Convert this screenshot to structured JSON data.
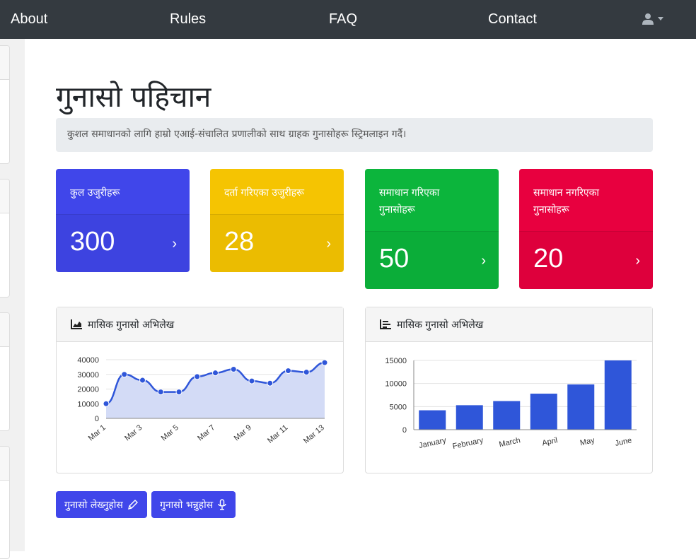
{
  "nav": {
    "about": "About",
    "rules": "Rules",
    "faq": "FAQ",
    "contact": "Contact",
    "user_icon": "user-icon"
  },
  "header": {
    "title": "गुनासो पहिचान",
    "lead": "कुशल समाधानको लागि हाम्रो एआई-संचालित प्रणालीको साथ ग्राहक गुनासोहरू स्ट्रिमलाइन गर्दै।"
  },
  "stats": [
    {
      "label": "कुल उजुरीहरू",
      "value": "300",
      "color": "#4046ea"
    },
    {
      "label": "दर्ता गरिएका उजुरीहरू",
      "value": "28",
      "color": "#f5c402"
    },
    {
      "label": "समाधान गरिएका गुनासोहरू",
      "value": "50",
      "color": "#0cb53c"
    },
    {
      "label": "समाधान नगरिएका गुनासोहरू",
      "value": "20",
      "color": "#e8003f"
    }
  ],
  "cards": {
    "line_title": "मासिक गुनासो अभिलेख",
    "bar_title": "मासिक गुनासो अभिलेख"
  },
  "buttons": {
    "write": "गुनासो लेख्नुहोस",
    "speak": "गुनासो भन्नुहोस"
  },
  "chart_data": [
    {
      "type": "area",
      "x": [
        "Mar 1",
        "Mar 2",
        "Mar 3",
        "Mar 4",
        "Mar 5",
        "Mar 6",
        "Mar 7",
        "Mar 8",
        "Mar 9",
        "Mar 10",
        "Mar 11",
        "Mar 12",
        "Mar 13"
      ],
      "x_tick_labels": [
        "Mar 1",
        "Mar 3",
        "Mar 5",
        "Mar 7",
        "Mar 9",
        "Mar 11",
        "Mar 13"
      ],
      "values": [
        10000,
        30000,
        26000,
        18000,
        18000,
        28500,
        31000,
        33500,
        25500,
        24000,
        32500,
        31500,
        38000
      ],
      "ylim": [
        0,
        40000
      ],
      "y_ticks": [
        0,
        10000,
        20000,
        30000,
        40000
      ],
      "color": "#2f56d9",
      "fill": "#d3dbf6",
      "grid": true
    },
    {
      "type": "bar",
      "categories": [
        "January",
        "February",
        "March",
        "April",
        "May",
        "June"
      ],
      "values": [
        4200,
        5300,
        6200,
        7800,
        9800,
        15000
      ],
      "ylim": [
        0,
        15000
      ],
      "y_ticks": [
        0,
        5000,
        10000,
        15000
      ],
      "color": "#2f56d9",
      "grid": true
    }
  ]
}
